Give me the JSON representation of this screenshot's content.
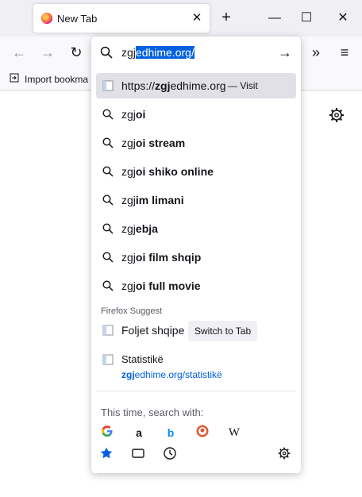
{
  "tab": {
    "title": "New Tab",
    "close": "✕"
  },
  "toolbar": {
    "new_tab": "+",
    "minimize": "—",
    "maximize": "☐",
    "close": "✕",
    "back": "←",
    "forward": "→",
    "reload": "↻",
    "overflow": "»",
    "menu": "≡"
  },
  "bookmarks": {
    "import_label": "Import bookma"
  },
  "urlbar": {
    "typed": "zgj",
    "selected_completion": "edhime.org/",
    "go_icon": "→"
  },
  "results": [
    {
      "type": "url",
      "prefix": "https://",
      "bold": "zgj",
      "rest": "edhime.org",
      "action": "— Visit",
      "icon": "page-icon"
    },
    {
      "type": "search",
      "prefix": "zgj",
      "bold": "oi",
      "icon": "search-icon"
    },
    {
      "type": "search",
      "prefix": "zgj",
      "bold": "oi stream",
      "icon": "search-icon"
    },
    {
      "type": "search",
      "prefix": "zgj",
      "bold": "oi shiko online",
      "icon": "search-icon"
    },
    {
      "type": "search",
      "prefix": "zgj",
      "bold": "im limani",
      "icon": "search-icon"
    },
    {
      "type": "search",
      "prefix": "zgj",
      "bold": "ebja",
      "icon": "search-icon"
    },
    {
      "type": "search",
      "prefix": "zgj",
      "bold": "oi film shqip",
      "icon": "search-icon"
    },
    {
      "type": "search",
      "prefix": "zgj",
      "bold": "oi full movie",
      "icon": "search-icon"
    }
  ],
  "suggest": {
    "heading": "Firefox Suggest",
    "tab_item": {
      "label": "Foljet shqipe",
      "button": "Switch to Tab"
    },
    "page_item": {
      "title": "Statistikë",
      "url_bold": "zgj",
      "url_rest": "edhime.org/statistikë"
    }
  },
  "engines": {
    "label": "This time, search with:",
    "items": [
      "google-icon",
      "amazon-icon",
      "bing-icon",
      "duckduckgo-icon",
      "wikipedia-icon"
    ],
    "wikipedia_glyph": "W",
    "amazon_glyph": "a",
    "bing_glyph": "b"
  },
  "colors": {
    "accent": "#0061e0",
    "selected_row": "#e0e0e6"
  }
}
